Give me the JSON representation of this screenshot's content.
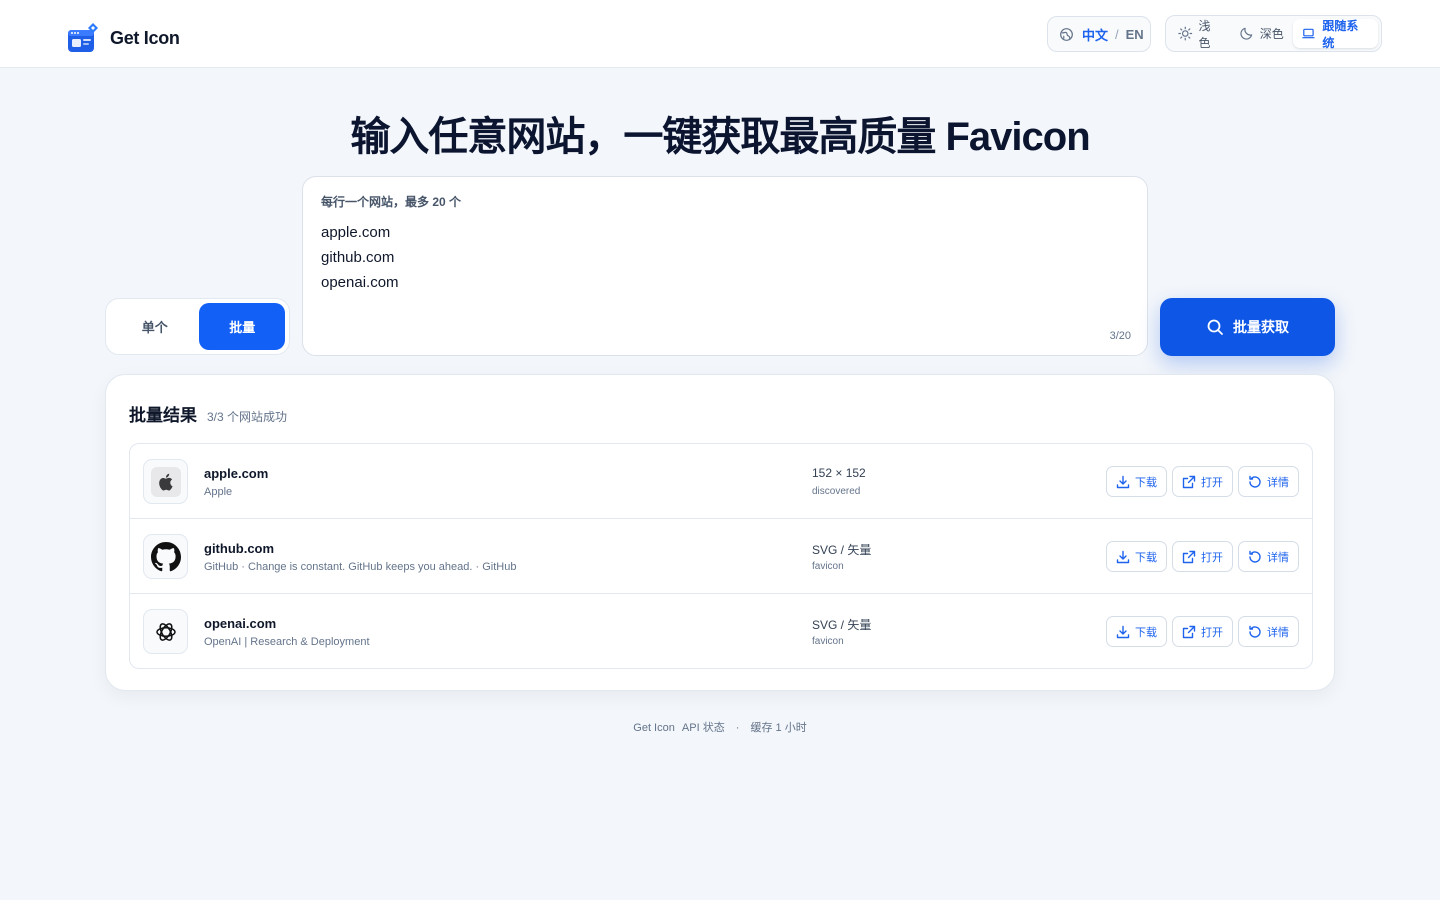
{
  "header": {
    "brand_name": "Get Icon",
    "lang": {
      "zh": "中文",
      "sep": "/",
      "en": "EN"
    },
    "theme": {
      "light": "浅色",
      "dark": "深色",
      "system": "跟随系统"
    }
  },
  "hero": {
    "title": "输入任意网站，一键获取最高质量 Favicon"
  },
  "mode": {
    "single": "单个",
    "batch": "批量",
    "selected": "batch"
  },
  "input": {
    "label": "每行一个网站，最多 20 个",
    "lines": [
      "apple.com",
      "github.com",
      "openai.com"
    ],
    "counter": "3/20"
  },
  "fetch_button": {
    "label": "批量获取"
  },
  "results": {
    "title": "批量结果",
    "count": "3/3 个网站成功",
    "items": [
      {
        "domain": "apple.com",
        "description": "Apple",
        "size": "152 × 152",
        "source": "discovered",
        "icon": "apple-icon"
      },
      {
        "domain": "github.com",
        "description": "GitHub · Change is constant. GitHub keeps you ahead. · GitHub",
        "size": "SVG / 矢量",
        "source": "favicon",
        "icon": "github-icon"
      },
      {
        "domain": "openai.com",
        "description": "OpenAI | Research & Deployment",
        "size": "SVG / 矢量",
        "source": "favicon",
        "icon": "openai-icon"
      }
    ],
    "actions": {
      "download": "下载",
      "open": "打开",
      "detail": "详情"
    }
  },
  "footer": {
    "brand": "Get Icon",
    "api": "API 状态",
    "sep": "·",
    "cache": "缓存 1 小时"
  },
  "colors": {
    "accent": "#1260f6",
    "background": "#f3f6fa"
  }
}
